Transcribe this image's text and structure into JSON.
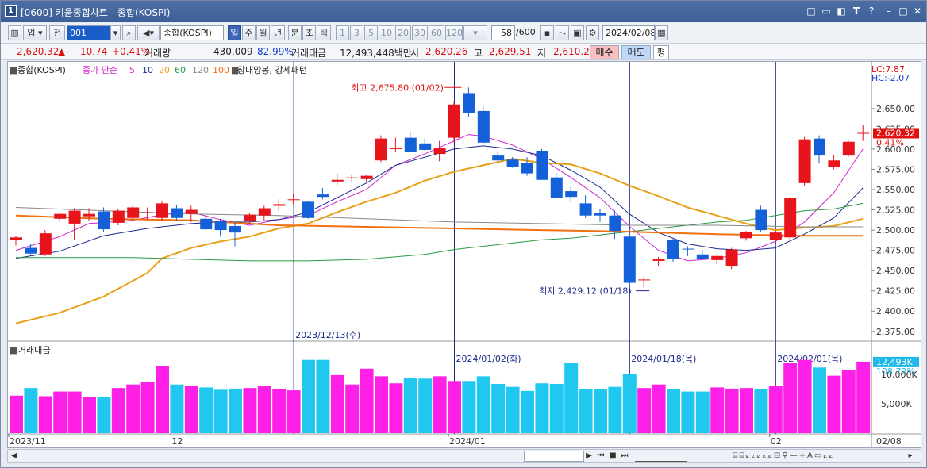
{
  "window": {
    "icon_label": "1",
    "title": "[0600] 키움종합차트 - 종합(KOSPI)",
    "buttons": [
      "□",
      "▭",
      "◧",
      "T",
      "?",
      "–",
      "□",
      "✕"
    ]
  },
  "toolbar": {
    "market": "업",
    "jeon": "전",
    "code": "001",
    "name": "종합(KOSPI)",
    "periods": [
      "일",
      "주",
      "월",
      "년",
      "분",
      "초",
      "틱"
    ],
    "active_period": "일",
    "intervals": [
      "1",
      "3",
      "5",
      "10",
      "20",
      "30",
      "60",
      "120"
    ],
    "count": "58",
    "count_max": "/600",
    "date": "2024/02/08"
  },
  "quote": {
    "price": "2,620.32",
    "change": "10.74",
    "change_pct": "+0.41%",
    "volume_label": "거래량",
    "volume": "430,009",
    "volume_ratio": "82.99%",
    "amount_label": "거래대금",
    "amount": "12,493,448백만",
    "open_label": "시",
    "open": "2,620.26",
    "high_label": "고",
    "high": "2,629.51",
    "low_label": "저",
    "low": "2,610.2",
    "buy_label": "매수",
    "sell_label": "매도",
    "eval_label": "평"
  },
  "legend": {
    "main": "종합(KOSPI)",
    "ma_title": "종가 단순",
    "ma_periods": [
      "5",
      "10",
      "20",
      "60",
      "120",
      "100"
    ],
    "pattern": "장대양봉, 강세패턴",
    "volume_title": "거래대금"
  },
  "colors": {
    "up": "#e8141c",
    "down": "#1460d8",
    "ma5": "#d020d0",
    "ma10": "#1a2a8a",
    "ma20": "#e8a018",
    "ma60": "#2a9a40",
    "ma120": "#888888",
    "ma_orange": "#f07010",
    "vol_up": "#ff20e8",
    "vol_down": "#20c8f0"
  },
  "annotations": {
    "high": "최고 2,675.80 (01/02)",
    "low": "최저 2,429.12 (01/18)",
    "lc": "LC:7.87",
    "hc": "HC:-2.07",
    "current_price": "2,620.32",
    "current_pct": "0.41%",
    "vol_current": "12,493K",
    "vol_pct": "108.72%"
  },
  "vlines": [
    {
      "label": "2023/12/13(수)"
    },
    {
      "label": "2024/01/02(화)"
    },
    {
      "label": "2024/01/18(목)"
    },
    {
      "label": "2024/02/01(목)"
    }
  ],
  "x_axis": {
    "labels": [
      "2023/11",
      "12",
      "2024/01",
      "02",
      "02/08"
    ]
  },
  "y_axis": {
    "price_ticks": [
      "2,650.00",
      "2,625.00",
      "2,600.00",
      "2,575.00",
      "2,550.00",
      "2,525.00",
      "2,500.00",
      "2,475.00",
      "2,450.00",
      "2,425.00",
      "2,400.00",
      "2,375.00"
    ],
    "volume_ticks": [
      "10,000K",
      "5,000K"
    ]
  },
  "chart_data": {
    "type": "candlestick",
    "title": "종합(KOSPI)",
    "price_range": [
      2365,
      2690
    ],
    "volume_range": [
      0,
      13000
    ],
    "candles": [
      {
        "o": 2488,
        "h": 2493,
        "l": 2481,
        "c": 2491,
        "v": 6.4
      },
      {
        "o": 2478,
        "h": 2483,
        "l": 2470,
        "c": 2471,
        "v": 7.7
      },
      {
        "o": 2470,
        "h": 2500,
        "l": 2468,
        "c": 2496,
        "v": 6.3
      },
      {
        "o": 2514,
        "h": 2522,
        "l": 2510,
        "c": 2520,
        "v": 7.1
      },
      {
        "o": 2508,
        "h": 2527,
        "l": 2488,
        "c": 2524,
        "v": 7.1
      },
      {
        "o": 2517,
        "h": 2527,
        "l": 2512,
        "c": 2520,
        "v": 6.1
      },
      {
        "o": 2523,
        "h": 2528,
        "l": 2498,
        "c": 2501,
        "v": 6.1
      },
      {
        "o": 2509,
        "h": 2526,
        "l": 2506,
        "c": 2524,
        "v": 7.7
      },
      {
        "o": 2515,
        "h": 2530,
        "l": 2512,
        "c": 2528,
        "v": 8.3
      },
      {
        "o": 2522,
        "h": 2528,
        "l": 2513,
        "c": 2522,
        "v": 8.8
      },
      {
        "o": 2515,
        "h": 2536,
        "l": 2512,
        "c": 2533,
        "v": 11.5
      },
      {
        "o": 2527,
        "h": 2531,
        "l": 2512,
        "c": 2515,
        "v": 8.3
      },
      {
        "o": 2520,
        "h": 2530,
        "l": 2510,
        "c": 2525,
        "v": 8.1
      },
      {
        "o": 2514,
        "h": 2518,
        "l": 2500,
        "c": 2501,
        "v": 7.8
      },
      {
        "o": 2511,
        "h": 2514,
        "l": 2492,
        "c": 2500,
        "v": 7.4
      },
      {
        "o": 2505,
        "h": 2510,
        "l": 2480,
        "c": 2497,
        "v": 7.6
      },
      {
        "o": 2511,
        "h": 2521,
        "l": 2507,
        "c": 2519,
        "v": 7.7
      },
      {
        "o": 2518,
        "h": 2530,
        "l": 2512,
        "c": 2527,
        "v": 8.1
      },
      {
        "o": 2530,
        "h": 2538,
        "l": 2524,
        "c": 2532,
        "v": 7.5
      },
      {
        "o": 2537,
        "h": 2545,
        "l": 2532,
        "c": 2538,
        "v": 7.3
      },
      {
        "o": 2535,
        "h": 2536,
        "l": 2514,
        "c": 2515,
        "v": 12.5
      },
      {
        "o": 2544,
        "h": 2552,
        "l": 2538,
        "c": 2541,
        "v": 12.5
      },
      {
        "o": 2560,
        "h": 2570,
        "l": 2556,
        "c": 2562,
        "v": 9.9
      },
      {
        "o": 2564,
        "h": 2568,
        "l": 2560,
        "c": 2565,
        "v": 8.3
      },
      {
        "o": 2563,
        "h": 2568,
        "l": 2560,
        "c": 2567,
        "v": 11.0
      },
      {
        "o": 2586,
        "h": 2617,
        "l": 2584,
        "c": 2613,
        "v": 9.7
      },
      {
        "o": 2600,
        "h": 2614,
        "l": 2596,
        "c": 2601,
        "v": 8.5
      },
      {
        "o": 2614,
        "h": 2621,
        "l": 2597,
        "c": 2597,
        "v": 9.4
      },
      {
        "o": 2607,
        "h": 2613,
        "l": 2598,
        "c": 2599,
        "v": 9.3
      },
      {
        "o": 2594,
        "h": 2610,
        "l": 2585,
        "c": 2601,
        "v": 9.7
      },
      {
        "o": 2614,
        "h": 2659,
        "l": 2608,
        "c": 2655,
        "v": 8.9
      },
      {
        "o": 2669,
        "h": 2676,
        "l": 2640,
        "c": 2645,
        "v": 8.9
      },
      {
        "o": 2647,
        "h": 2652,
        "l": 2606,
        "c": 2608,
        "v": 9.7
      },
      {
        "o": 2592,
        "h": 2596,
        "l": 2583,
        "c": 2586,
        "v": 8.4
      },
      {
        "o": 2587,
        "h": 2590,
        "l": 2577,
        "c": 2578,
        "v": 7.9
      },
      {
        "o": 2583,
        "h": 2590,
        "l": 2567,
        "c": 2570,
        "v": 7.2
      },
      {
        "o": 2598,
        "h": 2600,
        "l": 2562,
        "c": 2562,
        "v": 8.5
      },
      {
        "o": 2565,
        "h": 2570,
        "l": 2540,
        "c": 2540,
        "v": 8.4
      },
      {
        "o": 2548,
        "h": 2553,
        "l": 2535,
        "c": 2541,
        "v": 12.0
      },
      {
        "o": 2533,
        "h": 2543,
        "l": 2515,
        "c": 2518,
        "v": 7.5
      },
      {
        "o": 2521,
        "h": 2526,
        "l": 2510,
        "c": 2518,
        "v": 7.5
      },
      {
        "o": 2518,
        "h": 2524,
        "l": 2489,
        "c": 2499,
        "v": 7.9
      },
      {
        "o": 2492,
        "h": 2496,
        "l": 2430,
        "c": 2435,
        "v": 10.1
      },
      {
        "o": 2438,
        "h": 2442,
        "l": 2429,
        "c": 2439,
        "v": 7.7
      },
      {
        "o": 2462,
        "h": 2467,
        "l": 2456,
        "c": 2464,
        "v": 8.3
      },
      {
        "o": 2488,
        "h": 2490,
        "l": 2461,
        "c": 2464,
        "v": 7.5
      },
      {
        "o": 2477,
        "h": 2480,
        "l": 2468,
        "c": 2476,
        "v": 7.1
      },
      {
        "o": 2470,
        "h": 2476,
        "l": 2465,
        "c": 2464,
        "v": 7.1
      },
      {
        "o": 2463,
        "h": 2470,
        "l": 2458,
        "c": 2468,
        "v": 7.8
      },
      {
        "o": 2456,
        "h": 2478,
        "l": 2452,
        "c": 2476,
        "v": 7.6
      },
      {
        "o": 2490,
        "h": 2499,
        "l": 2487,
        "c": 2498,
        "v": 7.7
      },
      {
        "o": 2525,
        "h": 2530,
        "l": 2498,
        "c": 2500,
        "v": 7.5
      },
      {
        "o": 2488,
        "h": 2500,
        "l": 2485,
        "c": 2497,
        "v": 8.0
      },
      {
        "o": 2491,
        "h": 2541,
        "l": 2488,
        "c": 2540,
        "v": 12.0
      },
      {
        "o": 2558,
        "h": 2615,
        "l": 2555,
        "c": 2612,
        "v": 12.5
      },
      {
        "o": 2613,
        "h": 2617,
        "l": 2582,
        "c": 2592,
        "v": 11.2
      },
      {
        "o": 2578,
        "h": 2593,
        "l": 2575,
        "c": 2586,
        "v": 9.8
      },
      {
        "o": 2592,
        "h": 2611,
        "l": 2590,
        "c": 2609,
        "v": 10.8
      },
      {
        "o": 2620,
        "h": 2630,
        "l": 2610,
        "c": 2620,
        "v": 12.2
      }
    ],
    "moving_averages": {
      "ma5": [
        [
          0,
          2475
        ],
        [
          3,
          2492
        ],
        [
          5,
          2508
        ],
        [
          8,
          2512
        ],
        [
          10,
          2519
        ],
        [
          12,
          2522
        ],
        [
          14,
          2513
        ],
        [
          16,
          2506
        ],
        [
          18,
          2513
        ],
        [
          20,
          2518
        ],
        [
          22,
          2535
        ],
        [
          24,
          2550
        ],
        [
          26,
          2580
        ],
        [
          28,
          2594
        ],
        [
          30,
          2610
        ],
        [
          31,
          2618
        ],
        [
          32,
          2616
        ],
        [
          34,
          2605
        ],
        [
          36,
          2588
        ],
        [
          38,
          2565
        ],
        [
          40,
          2540
        ],
        [
          42,
          2505
        ],
        [
          44,
          2475
        ],
        [
          46,
          2462
        ],
        [
          48,
          2465
        ],
        [
          50,
          2472
        ],
        [
          52,
          2486
        ],
        [
          54,
          2510
        ],
        [
          56,
          2546
        ],
        [
          58,
          2600
        ]
      ],
      "ma10": [
        [
          0,
          2465
        ],
        [
          3,
          2474
        ],
        [
          6,
          2493
        ],
        [
          9,
          2502
        ],
        [
          12,
          2508
        ],
        [
          14,
          2510
        ],
        [
          16,
          2510
        ],
        [
          18,
          2513
        ],
        [
          20,
          2522
        ],
        [
          22,
          2540
        ],
        [
          24,
          2558
        ],
        [
          26,
          2580
        ],
        [
          28,
          2590
        ],
        [
          30,
          2600
        ],
        [
          32,
          2604
        ],
        [
          34,
          2600
        ],
        [
          36,
          2592
        ],
        [
          38,
          2574
        ],
        [
          40,
          2553
        ],
        [
          42,
          2520
        ],
        [
          44,
          2497
        ],
        [
          46,
          2483
        ],
        [
          48,
          2477
        ],
        [
          50,
          2475
        ],
        [
          52,
          2478
        ],
        [
          54,
          2495
        ],
        [
          56,
          2515
        ],
        [
          58,
          2552
        ]
      ],
      "ma20": [
        [
          0,
          2385
        ],
        [
          3,
          2398
        ],
        [
          6,
          2418
        ],
        [
          9,
          2447
        ],
        [
          10,
          2465
        ],
        [
          12,
          2478
        ],
        [
          14,
          2486
        ],
        [
          16,
          2492
        ],
        [
          18,
          2502
        ],
        [
          20,
          2508
        ],
        [
          22,
          2522
        ],
        [
          24,
          2535
        ],
        [
          26,
          2546
        ],
        [
          28,
          2561
        ],
        [
          30,
          2572
        ],
        [
          32,
          2580
        ],
        [
          34,
          2588
        ],
        [
          36,
          2583
        ],
        [
          38,
          2581
        ],
        [
          40,
          2570
        ],
        [
          42,
          2555
        ],
        [
          44,
          2542
        ],
        [
          46,
          2528
        ],
        [
          48,
          2518
        ],
        [
          50,
          2508
        ],
        [
          52,
          2500
        ],
        [
          54,
          2503
        ],
        [
          56,
          2505
        ],
        [
          58,
          2514
        ]
      ],
      "ma60": [
        [
          0,
          2466
        ],
        [
          4,
          2466
        ],
        [
          8,
          2466
        ],
        [
          12,
          2464
        ],
        [
          16,
          2462
        ],
        [
          20,
          2462
        ],
        [
          24,
          2464
        ],
        [
          28,
          2470
        ],
        [
          30,
          2476
        ],
        [
          32,
          2480
        ],
        [
          34,
          2484
        ],
        [
          36,
          2488
        ],
        [
          38,
          2490
        ],
        [
          40,
          2494
        ],
        [
          42,
          2498
        ],
        [
          44,
          2502
        ],
        [
          46,
          2506
        ],
        [
          48,
          2510
        ],
        [
          50,
          2512
        ],
        [
          52,
          2518
        ],
        [
          54,
          2524
        ],
        [
          56,
          2526
        ],
        [
          58,
          2533
        ]
      ],
      "ma120": [
        [
          0,
          2528
        ],
        [
          6,
          2524
        ],
        [
          12,
          2520
        ],
        [
          18,
          2518
        ],
        [
          24,
          2514
        ],
        [
          30,
          2510
        ],
        [
          36,
          2508
        ],
        [
          42,
          2506
        ],
        [
          48,
          2506
        ],
        [
          54,
          2504
        ],
        [
          58,
          2504
        ]
      ],
      "ma_orange": [
        [
          0,
          2518
        ],
        [
          6,
          2514
        ],
        [
          12,
          2512
        ],
        [
          18,
          2506
        ],
        [
          24,
          2504
        ],
        [
          30,
          2502
        ],
        [
          36,
          2500
        ],
        [
          42,
          2498
        ],
        [
          48,
          2495
        ],
        [
          54,
          2493
        ],
        [
          58,
          2493
        ]
      ]
    }
  }
}
